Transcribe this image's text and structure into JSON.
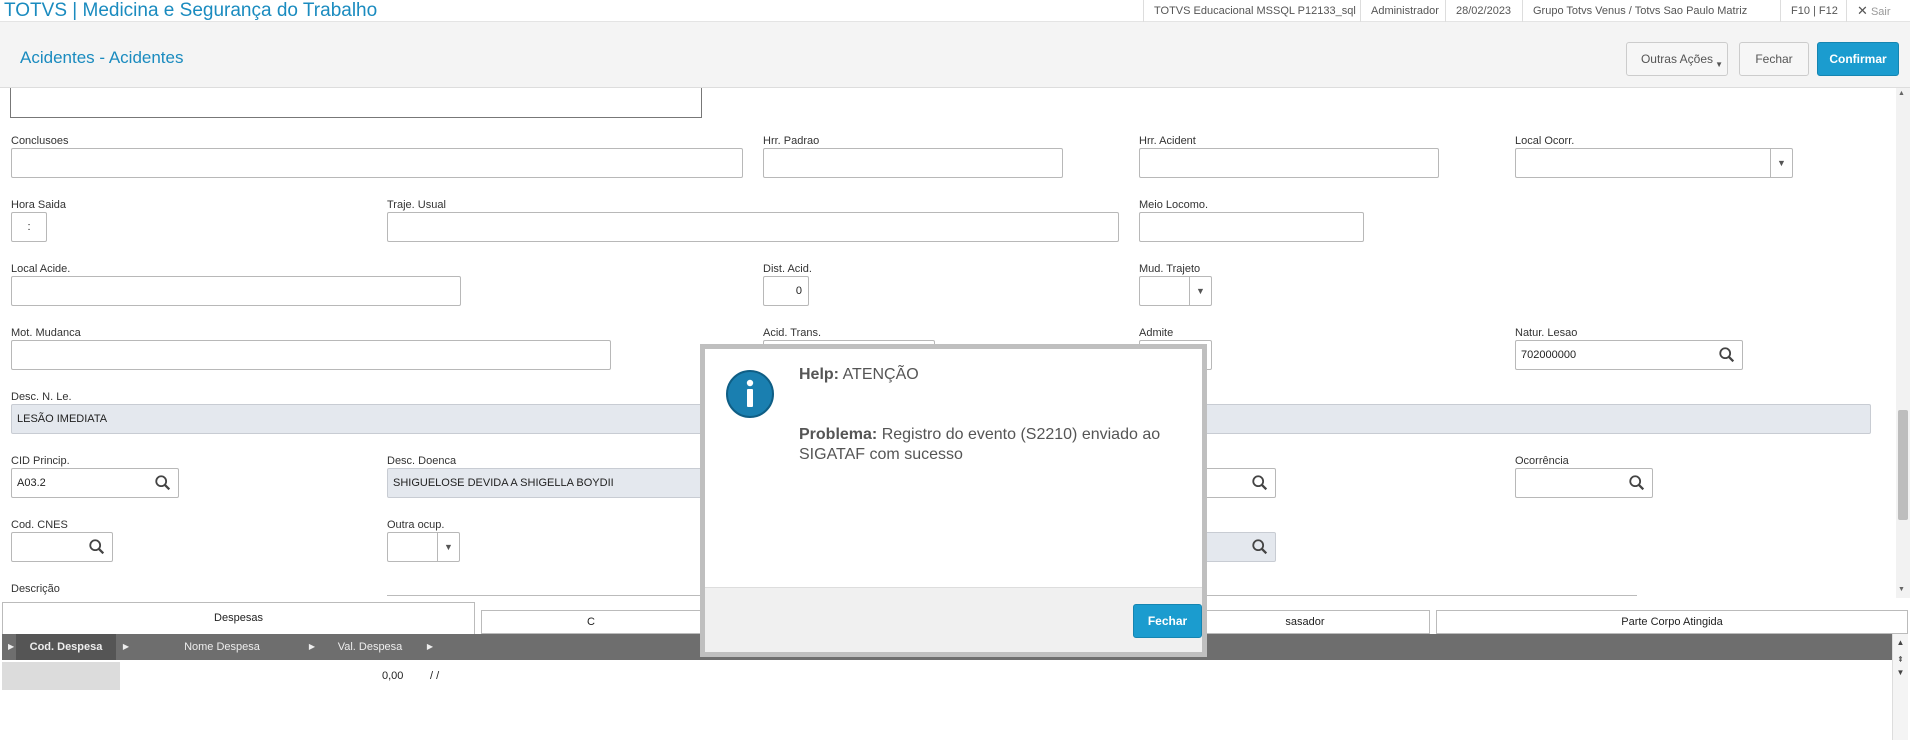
{
  "app": {
    "title": "TOTVS | Medicina e Segurança do Trabalho"
  },
  "topbar": {
    "environment": "TOTVS Educacional MSSQL P12133_sql",
    "user": "Administrador",
    "date": "28/02/2023",
    "company": "Grupo Totvs Venus / Totvs Sao Paulo Matriz",
    "shortcuts": "F10 | F12",
    "exit": "Sair"
  },
  "header": {
    "title": "Acidentes - Acidentes",
    "other_actions": "Outras Ações",
    "close": "Fechar",
    "confirm": "Confirmar"
  },
  "form": {
    "conclusoes": {
      "label": "Conclusoes",
      "value": ""
    },
    "hrr_padrao": {
      "label": "Hrr. Padrao",
      "value": ""
    },
    "hrr_acident": {
      "label": "Hrr. Acident",
      "value": ""
    },
    "local_ocorr": {
      "label": "Local Ocorr.",
      "value": ""
    },
    "hora_saida": {
      "label": "Hora Saida",
      "value": ":"
    },
    "traje_usual": {
      "label": "Traje. Usual",
      "value": ""
    },
    "meio_locomo": {
      "label": "Meio Locomo.",
      "value": ""
    },
    "local_acide": {
      "label": "Local Acide.",
      "value": ""
    },
    "dist_acid": {
      "label": "Dist. Acid.",
      "value": "0"
    },
    "mud_trajeto": {
      "label": "Mud. Trajeto",
      "value": ""
    },
    "mot_mudanca": {
      "label": "Mot. Mudanca",
      "value": ""
    },
    "acid_trans": {
      "label": "Acid. Trans.",
      "value": ""
    },
    "admite": {
      "label": "Admite",
      "value": ""
    },
    "natur_lesao": {
      "label": "Natur. Lesao",
      "value": "702000000"
    },
    "desc_n_le": {
      "label": "Desc. N. Le.",
      "value": "LESÃO IMEDIATA"
    },
    "cid_princip": {
      "label": "CID Princip.",
      "value": "A03.2"
    },
    "desc_doenca": {
      "label": "Desc. Doenca",
      "value": "SHIGUELOSE DEVIDA A SHIGELLA BOYDII"
    },
    "ocorrencia": {
      "label": "Ocorrência",
      "value": ""
    },
    "cod_cnes": {
      "label": "Cod. CNES",
      "value": ""
    },
    "outra_ocup": {
      "label": "Outra ocup.",
      "value": ""
    },
    "descricao": {
      "label": "Descrição"
    }
  },
  "tabs": [
    {
      "label": "Despesas"
    },
    {
      "label": "C"
    },
    {
      "label": "sasador"
    },
    {
      "label": "Parte Corpo Atingida"
    }
  ],
  "grid": {
    "columns": [
      "Cod. Despesa",
      "Nome Despesa",
      "Val. Despesa"
    ],
    "row": {
      "value": "0,00",
      "date": "/ /"
    }
  },
  "modal": {
    "help_label": "Help:",
    "help_title": "ATENÇÃO",
    "problem_label": "Problema:",
    "problem_text": "Registro do evento (S2210) enviado ao SIGATAF com sucesso",
    "close": "Fechar"
  }
}
